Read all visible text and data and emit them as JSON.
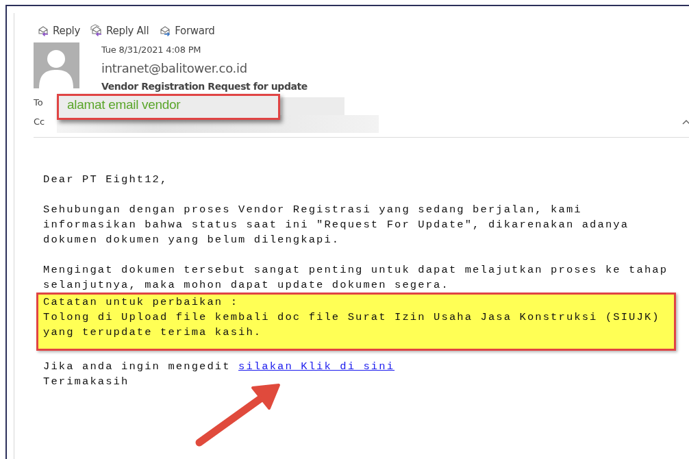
{
  "toolbar": [
    {
      "label": "Reply",
      "kind": "reply"
    },
    {
      "label": "Reply All",
      "kind": "reply_all"
    },
    {
      "label": "Forward",
      "kind": "forward"
    }
  ],
  "header": {
    "date": "Tue 8/31/2021 4:08 PM",
    "sender": "intranet@balitower.co.id",
    "subject": "Vendor Registration Request for update",
    "to_label": "To",
    "cc_label": "Cc",
    "annotation": "alamat email vendor"
  },
  "body": {
    "greeting": "Dear PT Eight12,",
    "paragraphs": [
      "Sehubungan dengan proses Vendor Registrasi yang sedang berjalan, kami\ninformasikan bahwa status saat ini \"Request For Update\", dikarenakan adanya\ndokumen dokumen yang belum dilengkapi.",
      "Mengingat dokumen tersebut sangat penting untuk dapat melajutkan proses ke tahap\nselanjutnya, maka mohon dapat update dokumen segera."
    ],
    "note": {
      "title": "Catatan untuk perbaikan :",
      "text": "Tolong di Upload file kembali doc file Surat Izin Usaha Jasa Konstruksi (SIUJK)\nyang terupdate terima kasih."
    },
    "edit_line": {
      "text": "Jika anda ingin mengedit",
      "link": "silakan Klik di sini"
    },
    "closing": "Terimakasih"
  }
}
